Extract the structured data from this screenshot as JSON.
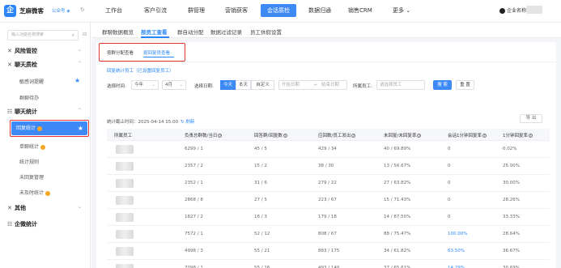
{
  "app": {
    "logo_glyph": "企",
    "brand": "芝麻微客",
    "corp": "公众号 ◈",
    "refresh_glyph": "↻"
  },
  "nav": {
    "items": [
      "工作台",
      "客户引流",
      "群管理",
      "营销获客",
      "会话质检",
      "数据归通",
      "销售CRM",
      "更多"
    ],
    "active_index": 4,
    "user": "企业名称"
  },
  "sidebar": {
    "search_placeholder": "输入功能名称搜索",
    "groups": [
      {
        "icon": "✕",
        "label": "风险管控"
      },
      {
        "icon": "✕",
        "label": "聊天质检"
      },
      {
        "icon": "☷",
        "label": "聊天统计"
      },
      {
        "icon": "✕",
        "label": "其他"
      },
      {
        "icon": "☷",
        "label": "企微统计"
      }
    ],
    "items": [
      "敏感词提醒",
      "群聊待办",
      "回复统计",
      "单聊统计",
      "统计规则",
      "未回复管理",
      "未及时统计"
    ],
    "active_item": "回复统计"
  },
  "subtabs": [
    "群聊数据概览",
    "按员工查看",
    "群自动分配",
    "数据过滤记录",
    "员工休假设置"
  ],
  "inner_tabs": [
    "按群分配查看",
    "按回复员查看"
  ],
  "filters": {
    "period_link": "回复统计员工（已设置回复员工）",
    "time_label": "选择时间:",
    "year": "今年",
    "month": "4月",
    "date_label": "选择日期:",
    "segments": [
      "今天",
      "本天",
      "自定义"
    ],
    "active_segment": 0,
    "start_placeholder": "开始日期",
    "end_placeholder": "结束日期",
    "employee_label": "所属员工:",
    "employee_placeholder": "请选择员工",
    "search_btn": "搜 索",
    "reset_btn": "重 置"
  },
  "deadline": {
    "text": "统计截止时间：2025-04-14 15:00",
    "refresh": "↻ 刷新"
  },
  "export_label": "导 出",
  "table": {
    "headers": [
      "所属员工",
      "负责总群数/当日",
      "回答群/回复数",
      "应回数/员工发出",
      "未回复/未回复率",
      "会话1分钟回复率",
      "1分钟回复率"
    ],
    "rows": [
      [
        "",
        "6299 / 1",
        "45 / 5",
        "429 / 34",
        "40 / 69.89%",
        "0",
        "0.02%"
      ],
      [
        "",
        "2357 / 2",
        "15 / 2",
        "38 / 30",
        "13 / 56.67%",
        "0",
        "25.00%"
      ],
      [
        "",
        "2352 / 1",
        "31 / 6",
        "279 / 22",
        "27 / 63.82%",
        "0",
        "30.00%"
      ],
      [
        "",
        "2868 / 8",
        "27 / 5",
        "223 / 67",
        "15 / 71.43%",
        "0",
        "28.26%"
      ],
      [
        "",
        "1827 / 2",
        "16 / 3",
        "179 / 18",
        "14 / 87.50%",
        "0",
        "33.33%"
      ],
      [
        "",
        "7572 / 1",
        "52 / 12",
        "808 / 67",
        "88 / 75.47%",
        "100.00%",
        "28.64%"
      ],
      [
        "",
        "4998 / 3",
        "55 / 21",
        "883 / 175",
        "34 / 61.82%",
        "63.50%",
        "36.67%"
      ],
      [
        "",
        "7098 / 1",
        "55 / 16",
        "493 / 140",
        "37 / 65.61%",
        "14.29%",
        "30.69%"
      ]
    ]
  },
  "colors": {
    "accent": "#3d8af7",
    "highlight_box": "#e5352b"
  },
  "icons": {
    "star": "★",
    "search": "⌕",
    "chevron_down": "⌄",
    "chevron_up": "⌃"
  }
}
